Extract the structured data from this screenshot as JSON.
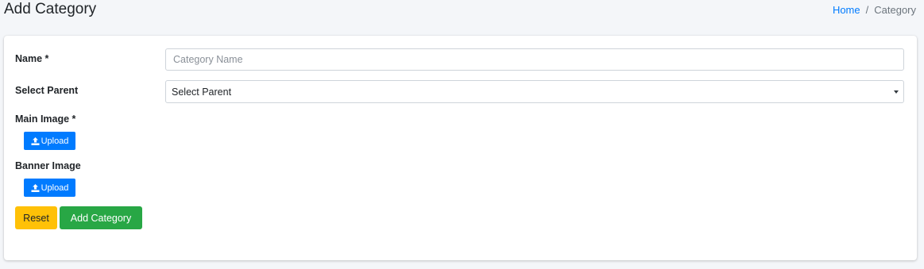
{
  "header": {
    "title": "Add Category",
    "breadcrumb": {
      "home": "Home",
      "separator": "/",
      "current": "Category"
    }
  },
  "form": {
    "name": {
      "label": "Name *",
      "value": "",
      "placeholder": "Category Name"
    },
    "parent": {
      "label": "Select Parent",
      "selected": "Select Parent"
    },
    "main_image": {
      "label": "Main Image *",
      "button_label": "Upload",
      "icon": "upload-icon"
    },
    "banner_image": {
      "label": "Banner Image",
      "button_label": "Upload",
      "icon": "upload-icon"
    },
    "actions": {
      "reset_label": "Reset",
      "submit_label": "Add Category"
    }
  },
  "colors": {
    "primary": "#007bff",
    "warning": "#ffc107",
    "success": "#28a745",
    "background": "#f4f6f9"
  }
}
